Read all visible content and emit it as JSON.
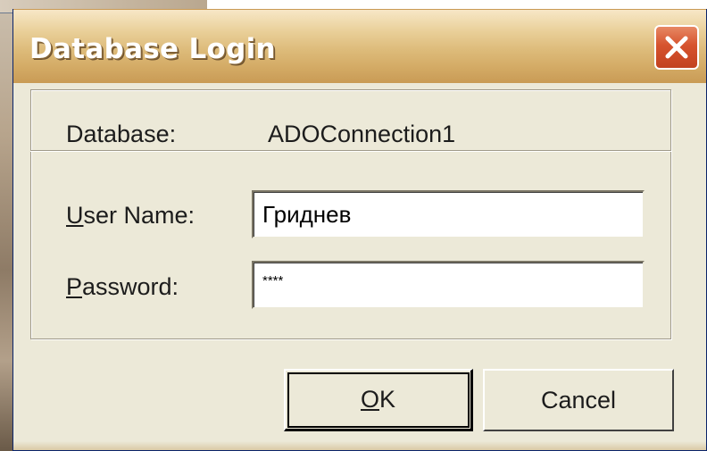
{
  "window": {
    "title": "Database Login"
  },
  "icons": {
    "close": "close-icon"
  },
  "form": {
    "database_label": "Database:",
    "database_value": "ADOConnection1",
    "username_label_prefix": "U",
    "username_label_rest": "ser Name:",
    "username_value": "Гриднев",
    "password_label_prefix": "P",
    "password_label_rest": "assword:",
    "password_value": "****"
  },
  "buttons": {
    "ok_prefix": "O",
    "ok_rest": "K",
    "cancel": "Cancel"
  },
  "colors": {
    "title_bar": "#ddbb7a",
    "close_button": "#d6532e",
    "dialog_face": "#ece9d8"
  }
}
